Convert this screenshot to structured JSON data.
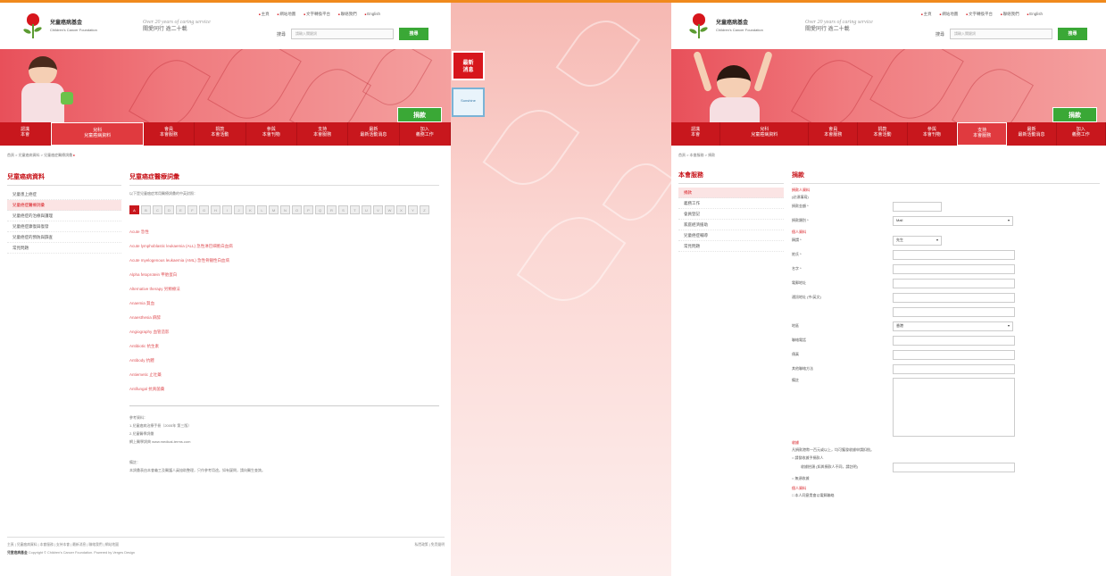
{
  "header": {
    "org_name_cn": "兒童癌病基金",
    "org_name_en": "Children's Cancer Foundation",
    "slogan_en": "Over 20 years of caring service",
    "slogan_cn": "關愛同行  逾二十載",
    "top_links": [
      "主頁",
      "網站地圖",
      "文字轉換平台",
      "聯絡我們",
      "English"
    ],
    "search_label": "搜尋",
    "search_placeholder": "請輸入關鍵詞",
    "search_button": "搜尋",
    "donate_button": "捐款"
  },
  "nav": [
    "認識\n本會",
    "兒科\n兒童癌病資料",
    "會員\n本會服務",
    "捐款\n本會活動",
    "參與\n本會刊物",
    "支持\n本會服務",
    "最新\n最新活動消息",
    "加入\n義務工作"
  ],
  "left_page": {
    "breadcrumb": "首頁 > 兒童癌病資料 > 兒童癌症醫療詞彙",
    "sidebar_title": "兒童癌病資料",
    "sidebar_items": [
      "兒童患上癌症",
      "兒童癌症醫療詞彙",
      "兒童癌症的治療與護理",
      "兒童癌症康復與復發",
      "兒童癌症的預防與篩查",
      "常見問題"
    ],
    "content_title": "兒童癌症醫療詞彙",
    "intro": "以下是兒童癌症常用醫療詞彙的中英對照：",
    "alphabet": [
      "A",
      "B",
      "C",
      "D",
      "E",
      "F",
      "G",
      "H",
      "I",
      "J",
      "K",
      "L",
      "M",
      "N",
      "O",
      "P",
      "Q",
      "R",
      "S",
      "T",
      "U",
      "V",
      "W",
      "X",
      "Y",
      "Z"
    ],
    "terms": [
      "Acute 急性",
      "Acute lymphoblastic leukaemia (ALL) 急性淋巴細胞白血病",
      "Acute myelogenous leukaemia (AML) 急性骨髓性白血病",
      "Alpha fetoprotein 甲胎蛋白",
      "Alternative therapy 另類療法",
      "Anaemia 貧血",
      "Anaesthesia 麻醉",
      "Angiography 血管造影",
      "Antibiotic 抗生素",
      "Antibody 抗體",
      "Antiemetic 止吐藥",
      "Antifungal 抗真菌藥"
    ],
    "refs_heading": "參考資料：",
    "refs": [
      "1.兒童癌病治療手冊（2005年 第三版）",
      "2.兒童醫學詞彙",
      "網上醫學詞典 www.medical-terms.com"
    ],
    "notes_heading": "備註：",
    "notes": "本詞彙表由本會義工及醫護人員協助整理，只作參考用途。如有疑問，請向醫生查詢。",
    "footer_links": "主頁 | 兒童癌病資料 | 本會服務 | 支持本會 | 最新消息 | 聯絡我們 | 網站地圖",
    "footer_right": "私隱政策 | 免責聲明",
    "footer_copy": "Copyright © Children's Cancer Foundation. Powered by Verges Design",
    "footer_org": "兒童癌病基金"
  },
  "middle": {
    "tile1": "最新\n消息",
    "tile2": "Sunshine"
  },
  "right_page": {
    "breadcrumb": "首頁 > 本會服務 > 捐款",
    "sidebar_title": "本會服務",
    "sidebar_items": [
      "捐款",
      "義務工作",
      "會員登記",
      "家庭經濟援助",
      "兒童癌症輔導",
      "常見問題"
    ],
    "form_title": "捐款",
    "sec_donor": "捐款人資料",
    "sec_donor_note": "(必須填寫)",
    "donation_amount_label": "捐款金額 *",
    "donation_type_label": "捐款類別 *",
    "donation_type_value": "Mail",
    "sec_personal": "個人資料",
    "title_label": "稱謂 *",
    "title_value": "先生",
    "surname_label": "姓氏 *",
    "given_name_label": "名字 *",
    "email_label": "電郵地址",
    "address_label": "通訊地址 (中/英文)",
    "district_label": "地區",
    "district_value": "香港",
    "phone_label": "聯絡電話",
    "fax_label": "傳真",
    "other_contact_label": "其他聯絡方法",
    "remarks_label": "備註",
    "sec_receipt": "收據",
    "receipt_note": "凡捐款港幣一百元或以上，均可獲發收據申請扣稅。",
    "receipt_opt1": "請發收據予捐款人",
    "receipt_opt2": "收據抬頭 (如與捐款人不同，請註明)",
    "receipt_opt3": "無須收據",
    "sec_consent": "個人資料",
    "consent_opt": "本人同意貴會以電郵聯絡"
  }
}
